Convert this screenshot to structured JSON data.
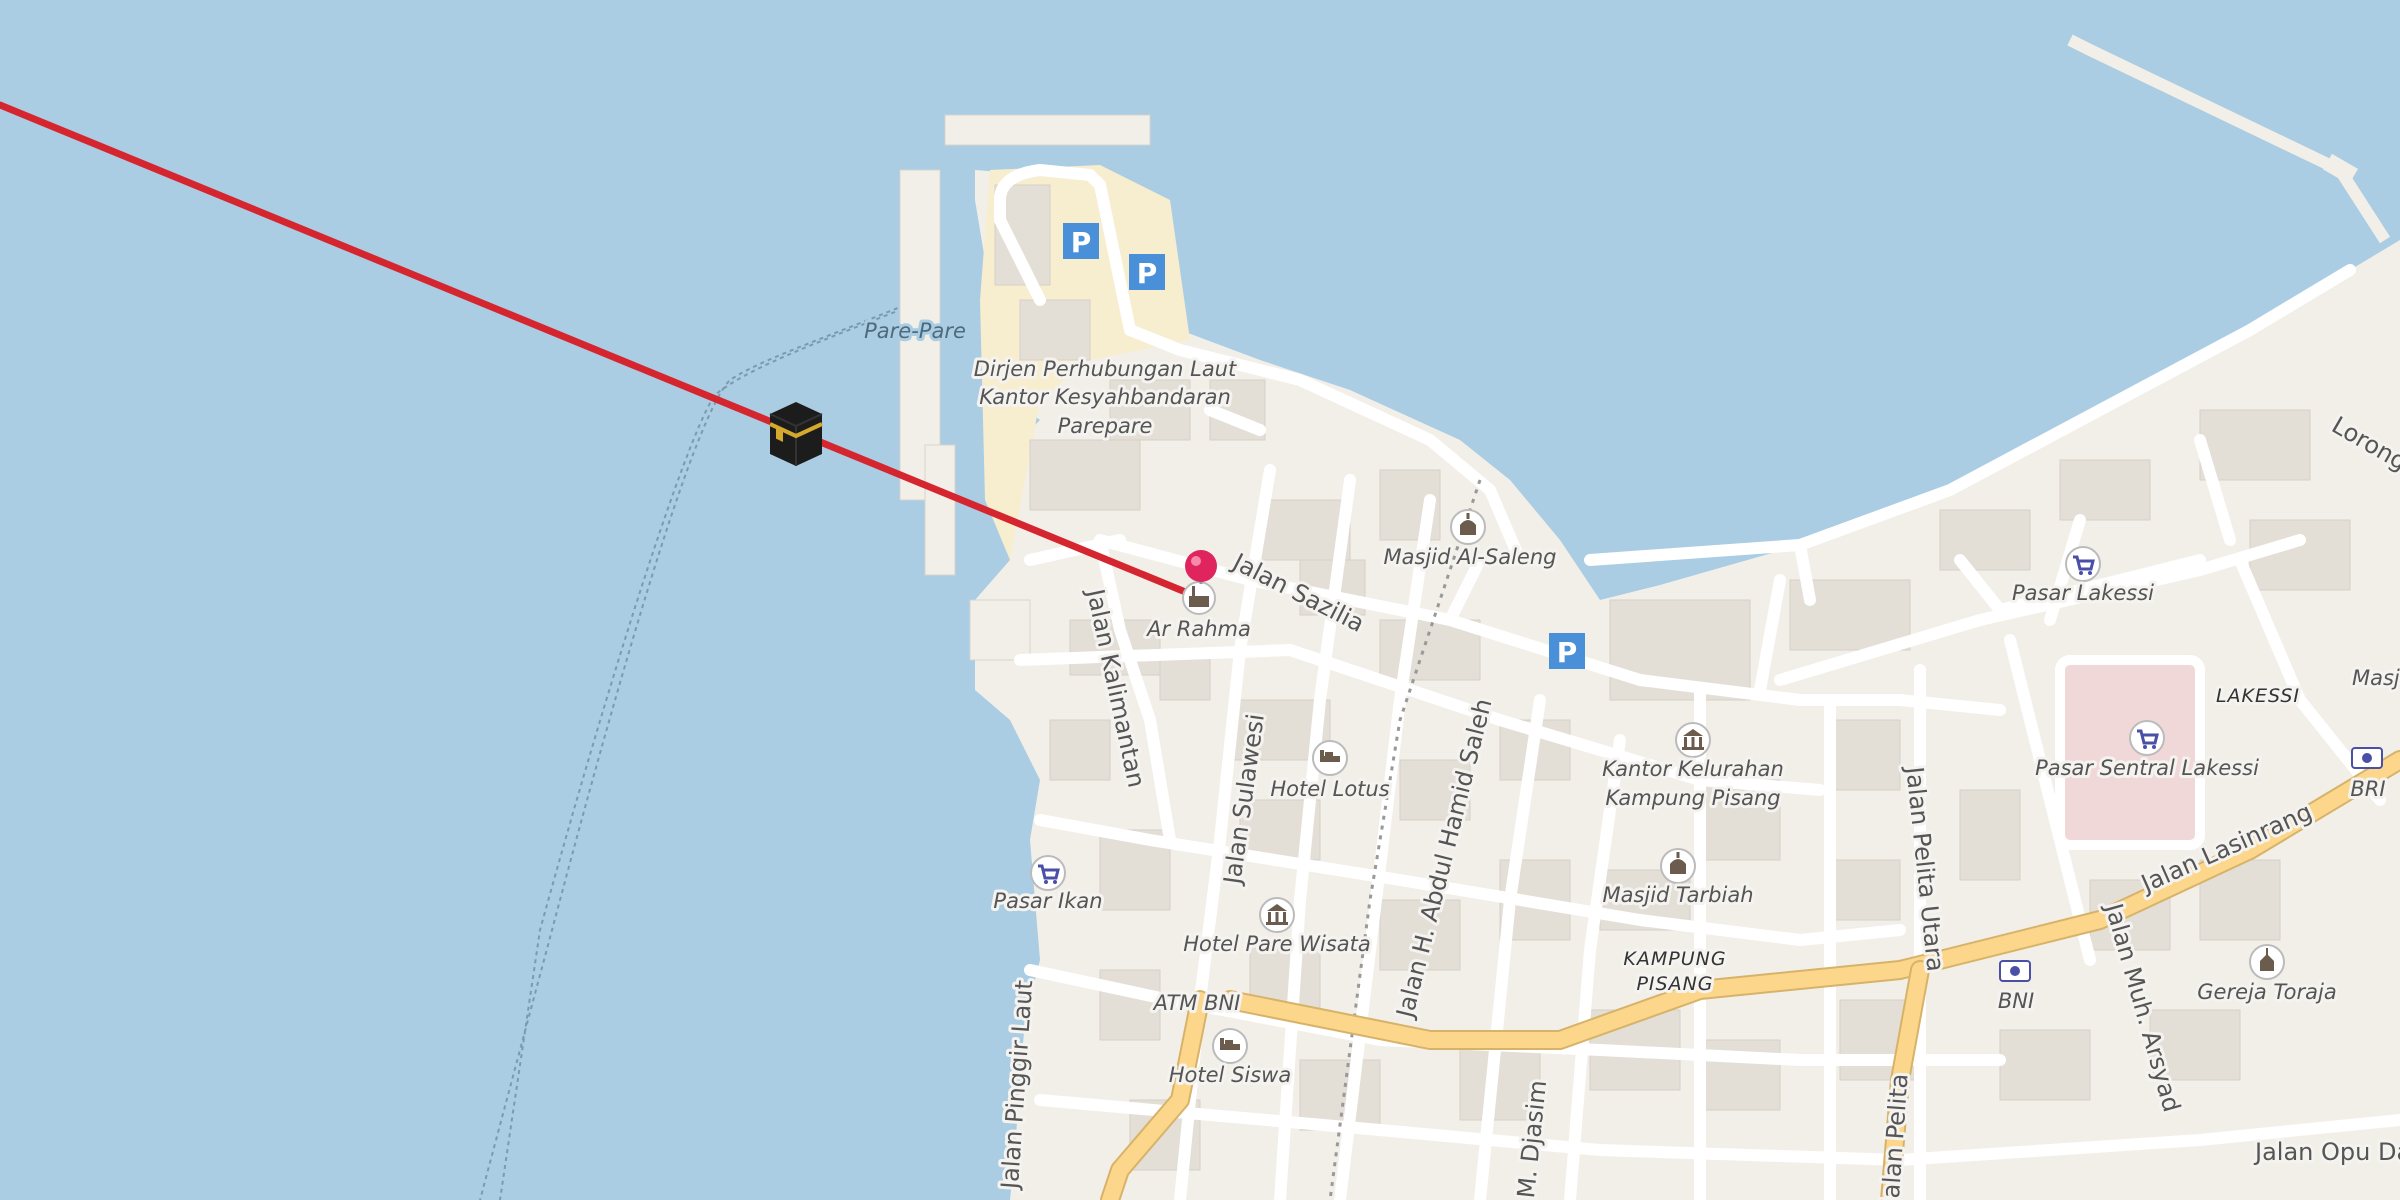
{
  "map": {
    "colors": {
      "water": "#aacde3",
      "land": "#f2efe9",
      "road": "#ffffff",
      "primary_road": "#fcd68b",
      "route_line": "#d5262f",
      "parking": "#4a90d9",
      "pin": "#e0245e"
    },
    "labels": {
      "pare_pare": "Pare-Pare",
      "dirjen_1": "Dirjen Perhubungan Laut",
      "dirjen_2": "Kantor Kesyahbandaran",
      "dirjen_3": "Parepare",
      "masjid_alsaleng": "Masjid Al-Saleng",
      "jalan_sazilia": "Jalan Sazilia",
      "ar_rahma": "Ar Rahma",
      "jalan_kalimantan": "Jalan Kalimantan",
      "jalan_sulawesi": "Jalan Sulawesi",
      "hotel_lotus": "Hotel Lotus",
      "jalan_hamid_saleh": "Jalan H. Abdul Hamid Saleh",
      "kantor_kel_1": "Kantor Kelurahan",
      "kantor_kel_2": "Kampung Pisang",
      "pasar_lakessi": "Pasar Lakessi",
      "lakessi": "LAKESSI",
      "pasar_sentral": "Pasar Sentral Lakessi",
      "bri": "BRI",
      "jalan_lasinrang": "Jalan Lasinrang",
      "jalan_pelita_utara": "Jalan Pelita Utara",
      "masjid_tarbiah": "Masjid Tarbiah",
      "kampung_pisang_1": "KAMPUNG",
      "kampung_pisang_2": "PISANG",
      "pasar_ikan": "Pasar Ikan",
      "hotel_pare_wisata": "Hotel Pare Wisata",
      "atm_bni": "ATM BNI",
      "bni": "BNI",
      "gereja_toraja": "Gereja Toraja",
      "jalan_muh_arsyad": "Jalan Muh. Arsyad",
      "hotel_siswa": "Hotel Siswa",
      "jalan_pinggir_laut": "Jalan Pinggir Laut",
      "m_djasim": "M. Djasim",
      "jalan_pelita": "Jalan Pelita",
      "jalan_opu_daeng": "Jalan Opu Daeng",
      "lorong": "Lorong",
      "masj": "Masj",
      "parking_1": "P",
      "parking_2": "P",
      "parking_3": "P"
    },
    "icons": {
      "kaaba": "kaaba-icon",
      "pin": "location-pin-icon",
      "mosque": "mosque-icon",
      "hotel": "bed-icon",
      "government": "government-building-icon",
      "market": "shopping-cart-icon",
      "bank": "banknote-icon",
      "church": "church-icon"
    }
  }
}
